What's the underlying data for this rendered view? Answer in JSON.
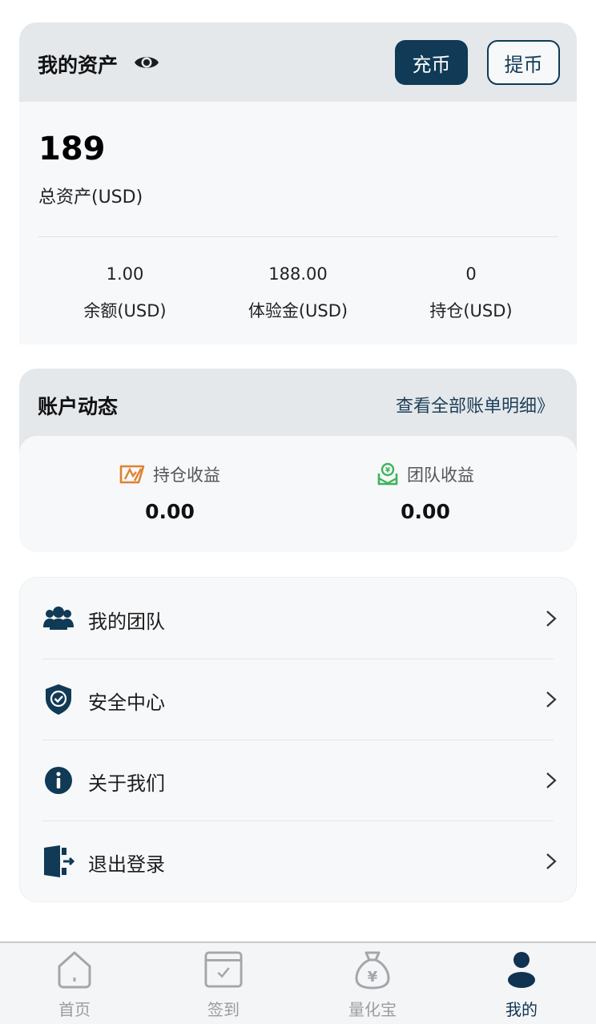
{
  "assets": {
    "title": "我的资产",
    "deposit_label": "充币",
    "withdraw_label": "提币",
    "total_value": "189",
    "total_label": "总资产(USD)",
    "stats": [
      {
        "value": "1.00",
        "label": "余额(USD)"
      },
      {
        "value": "188.00",
        "label": "体验金(USD)"
      },
      {
        "value": "0",
        "label": "持仓(USD)"
      }
    ]
  },
  "activity": {
    "title": "账户动态",
    "view_all": "查看全部账单明细》",
    "items": [
      {
        "label": "持仓收益",
        "value": "0.00",
        "icon": "position-earnings-icon",
        "color": "#e0822e"
      },
      {
        "label": "团队收益",
        "value": "0.00",
        "icon": "team-earnings-icon",
        "color": "#3bb45a"
      }
    ]
  },
  "menu": {
    "items": [
      {
        "label": "我的团队",
        "icon": "team-icon"
      },
      {
        "label": "安全中心",
        "icon": "shield-icon"
      },
      {
        "label": "关于我们",
        "icon": "info-icon"
      },
      {
        "label": "退出登录",
        "icon": "logout-icon"
      }
    ]
  },
  "tabbar": {
    "tabs": [
      {
        "label": "首页",
        "icon": "home-icon"
      },
      {
        "label": "签到",
        "icon": "check-in-icon"
      },
      {
        "label": "量化宝",
        "icon": "money-bag-icon"
      },
      {
        "label": "我的",
        "icon": "user-icon",
        "active": true
      }
    ]
  },
  "colors": {
    "primary": "#103a55",
    "header_bg": "#e4e8eb",
    "card_bg": "#f7f8fa",
    "inactive_tab": "#999ca1"
  }
}
